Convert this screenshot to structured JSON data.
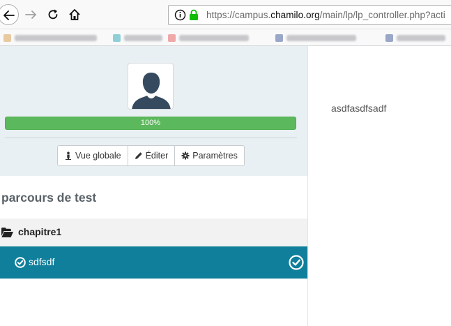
{
  "browser": {
    "url_prefix": "https://campus.",
    "url_host": "chamilo.org",
    "url_path": "/main/lp/lp_controller.php?acti",
    "bookmarks": [
      {
        "fav_color": "#e8c9a0",
        "w": 118
      },
      {
        "fav_color": "#8fd0d8",
        "w": 55
      },
      {
        "fav_color": "#f0a8a8",
        "w": 100
      },
      {
        "fav_color": "#9aa7c8",
        "w": 100
      },
      {
        "fav_color": "#9aa7c8",
        "w": 70
      }
    ]
  },
  "sidebar": {
    "progress_label": "100%",
    "progress_value": 1.0,
    "buttons": {
      "overview": "Vue globale",
      "edit": "Éditer",
      "settings": "Paramètres"
    },
    "lp_title": "parcours de test",
    "chapter_label": "chapitre1",
    "item_label": "sdfsdf"
  },
  "content": {
    "text": "asdfasdfsadf"
  },
  "colors": {
    "progress": "#5cb85c",
    "active_item": "#0f7f9b",
    "panel_bg": "#e9f0f3"
  }
}
